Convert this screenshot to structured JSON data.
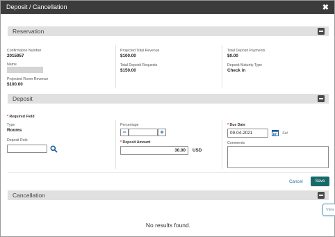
{
  "dialog": {
    "title": "Deposit / Cancellation",
    "close_glyph": "✖"
  },
  "reservation": {
    "section_label": "Reservation",
    "confirmation_number_label": "Confirmation Number",
    "confirmation_number": "2015957",
    "name_label": "Name",
    "projected_room_revenue_label": "Projected Room Revenue",
    "projected_room_revenue": "$100.00",
    "projected_total_revenue_label": "Projected Total Revenue",
    "projected_total_revenue": "$100.00",
    "total_deposit_requests_label": "Total Deposit Requests",
    "total_deposit_requests": "$150.00",
    "total_deposit_payments_label": "Total Deposit Payments",
    "total_deposit_payments": "$0.00",
    "deposit_maturity_type_label": "Deposit Maturity Type",
    "deposit_maturity_type": "Check in"
  },
  "deposit": {
    "section_label": "Deposit",
    "required_star": "*",
    "required_field_label": "Required Field",
    "type_label": "Type",
    "type_value": "Rooms",
    "deposit_rule_label": "Deposit Rule",
    "deposit_rule_value": "",
    "percentage_label": "Percentage",
    "percentage_value": "",
    "minus_glyph": "−",
    "plus_glyph": "+",
    "deposit_amount_label": "Deposit Amount",
    "deposit_amount_value": "30.00",
    "currency": "USD",
    "due_date_label": "Due Date",
    "due_date_value": "09-04-2021",
    "day_of_week": "Sat",
    "comments_label": "Comments",
    "comments_value": "",
    "cancel_label": "Cancel",
    "save_label": "Save"
  },
  "cancellation": {
    "section_label": "Cancellation",
    "no_results": "No results found.",
    "side_tab_label": "View"
  },
  "colors": {
    "titlebar": "#3c3c3c",
    "section_bar": "#e0e0e0",
    "primary_button": "#186a6a",
    "link": "#2a6aa8",
    "required": "#dd2222"
  },
  "icons": [
    "close-icon",
    "collapse-icon",
    "search-icon",
    "calendar-icon"
  ]
}
